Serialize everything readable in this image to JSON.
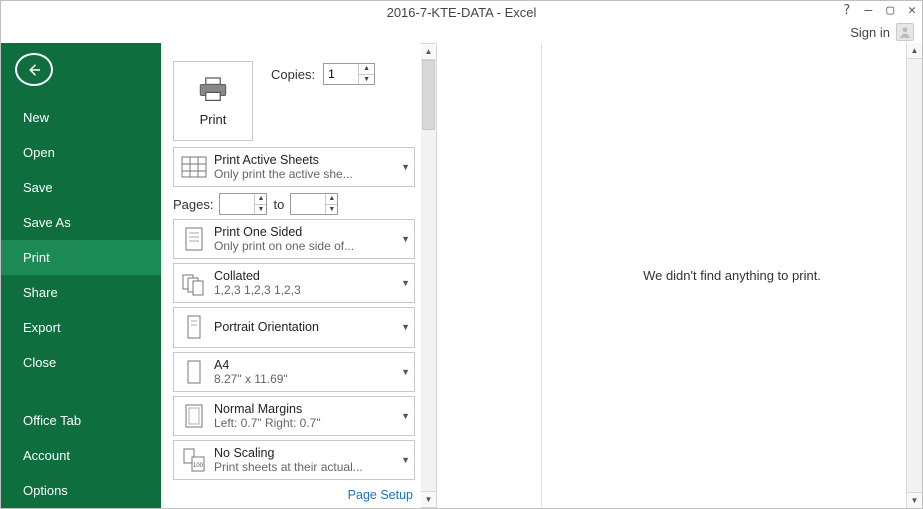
{
  "title": "2016-7-KTE-DATA - Excel",
  "signin": "Sign in",
  "sidebar": {
    "items": [
      {
        "label": "New"
      },
      {
        "label": "Open"
      },
      {
        "label": "Save"
      },
      {
        "label": "Save As"
      },
      {
        "label": "Print"
      },
      {
        "label": "Share"
      },
      {
        "label": "Export"
      },
      {
        "label": "Close"
      }
    ],
    "footer": [
      {
        "label": "Office Tab"
      },
      {
        "label": "Account"
      },
      {
        "label": "Options"
      }
    ],
    "active": 4
  },
  "print": {
    "button_label": "Print",
    "copies_label": "Copies:",
    "copies_value": "1",
    "pages_label": "Pages:",
    "pages_to": "to",
    "page_setup": "Page Setup",
    "options": {
      "active_sheets": {
        "title": "Print Active Sheets",
        "sub": "Only print the active she..."
      },
      "sided": {
        "title": "Print One Sided",
        "sub": "Only print on one side of..."
      },
      "collated": {
        "title": "Collated",
        "sub": "1,2,3    1,2,3    1,2,3"
      },
      "orientation": {
        "title": "Portrait Orientation",
        "sub": ""
      },
      "paper": {
        "title": "A4",
        "sub": "8.27\" x 11.69\""
      },
      "margins": {
        "title": "Normal Margins",
        "sub": "Left:  0.7\"    Right:  0.7\""
      },
      "scaling": {
        "title": "No Scaling",
        "sub": "Print sheets at their actual..."
      }
    }
  },
  "preview": {
    "message": "We didn't find anything to print."
  }
}
